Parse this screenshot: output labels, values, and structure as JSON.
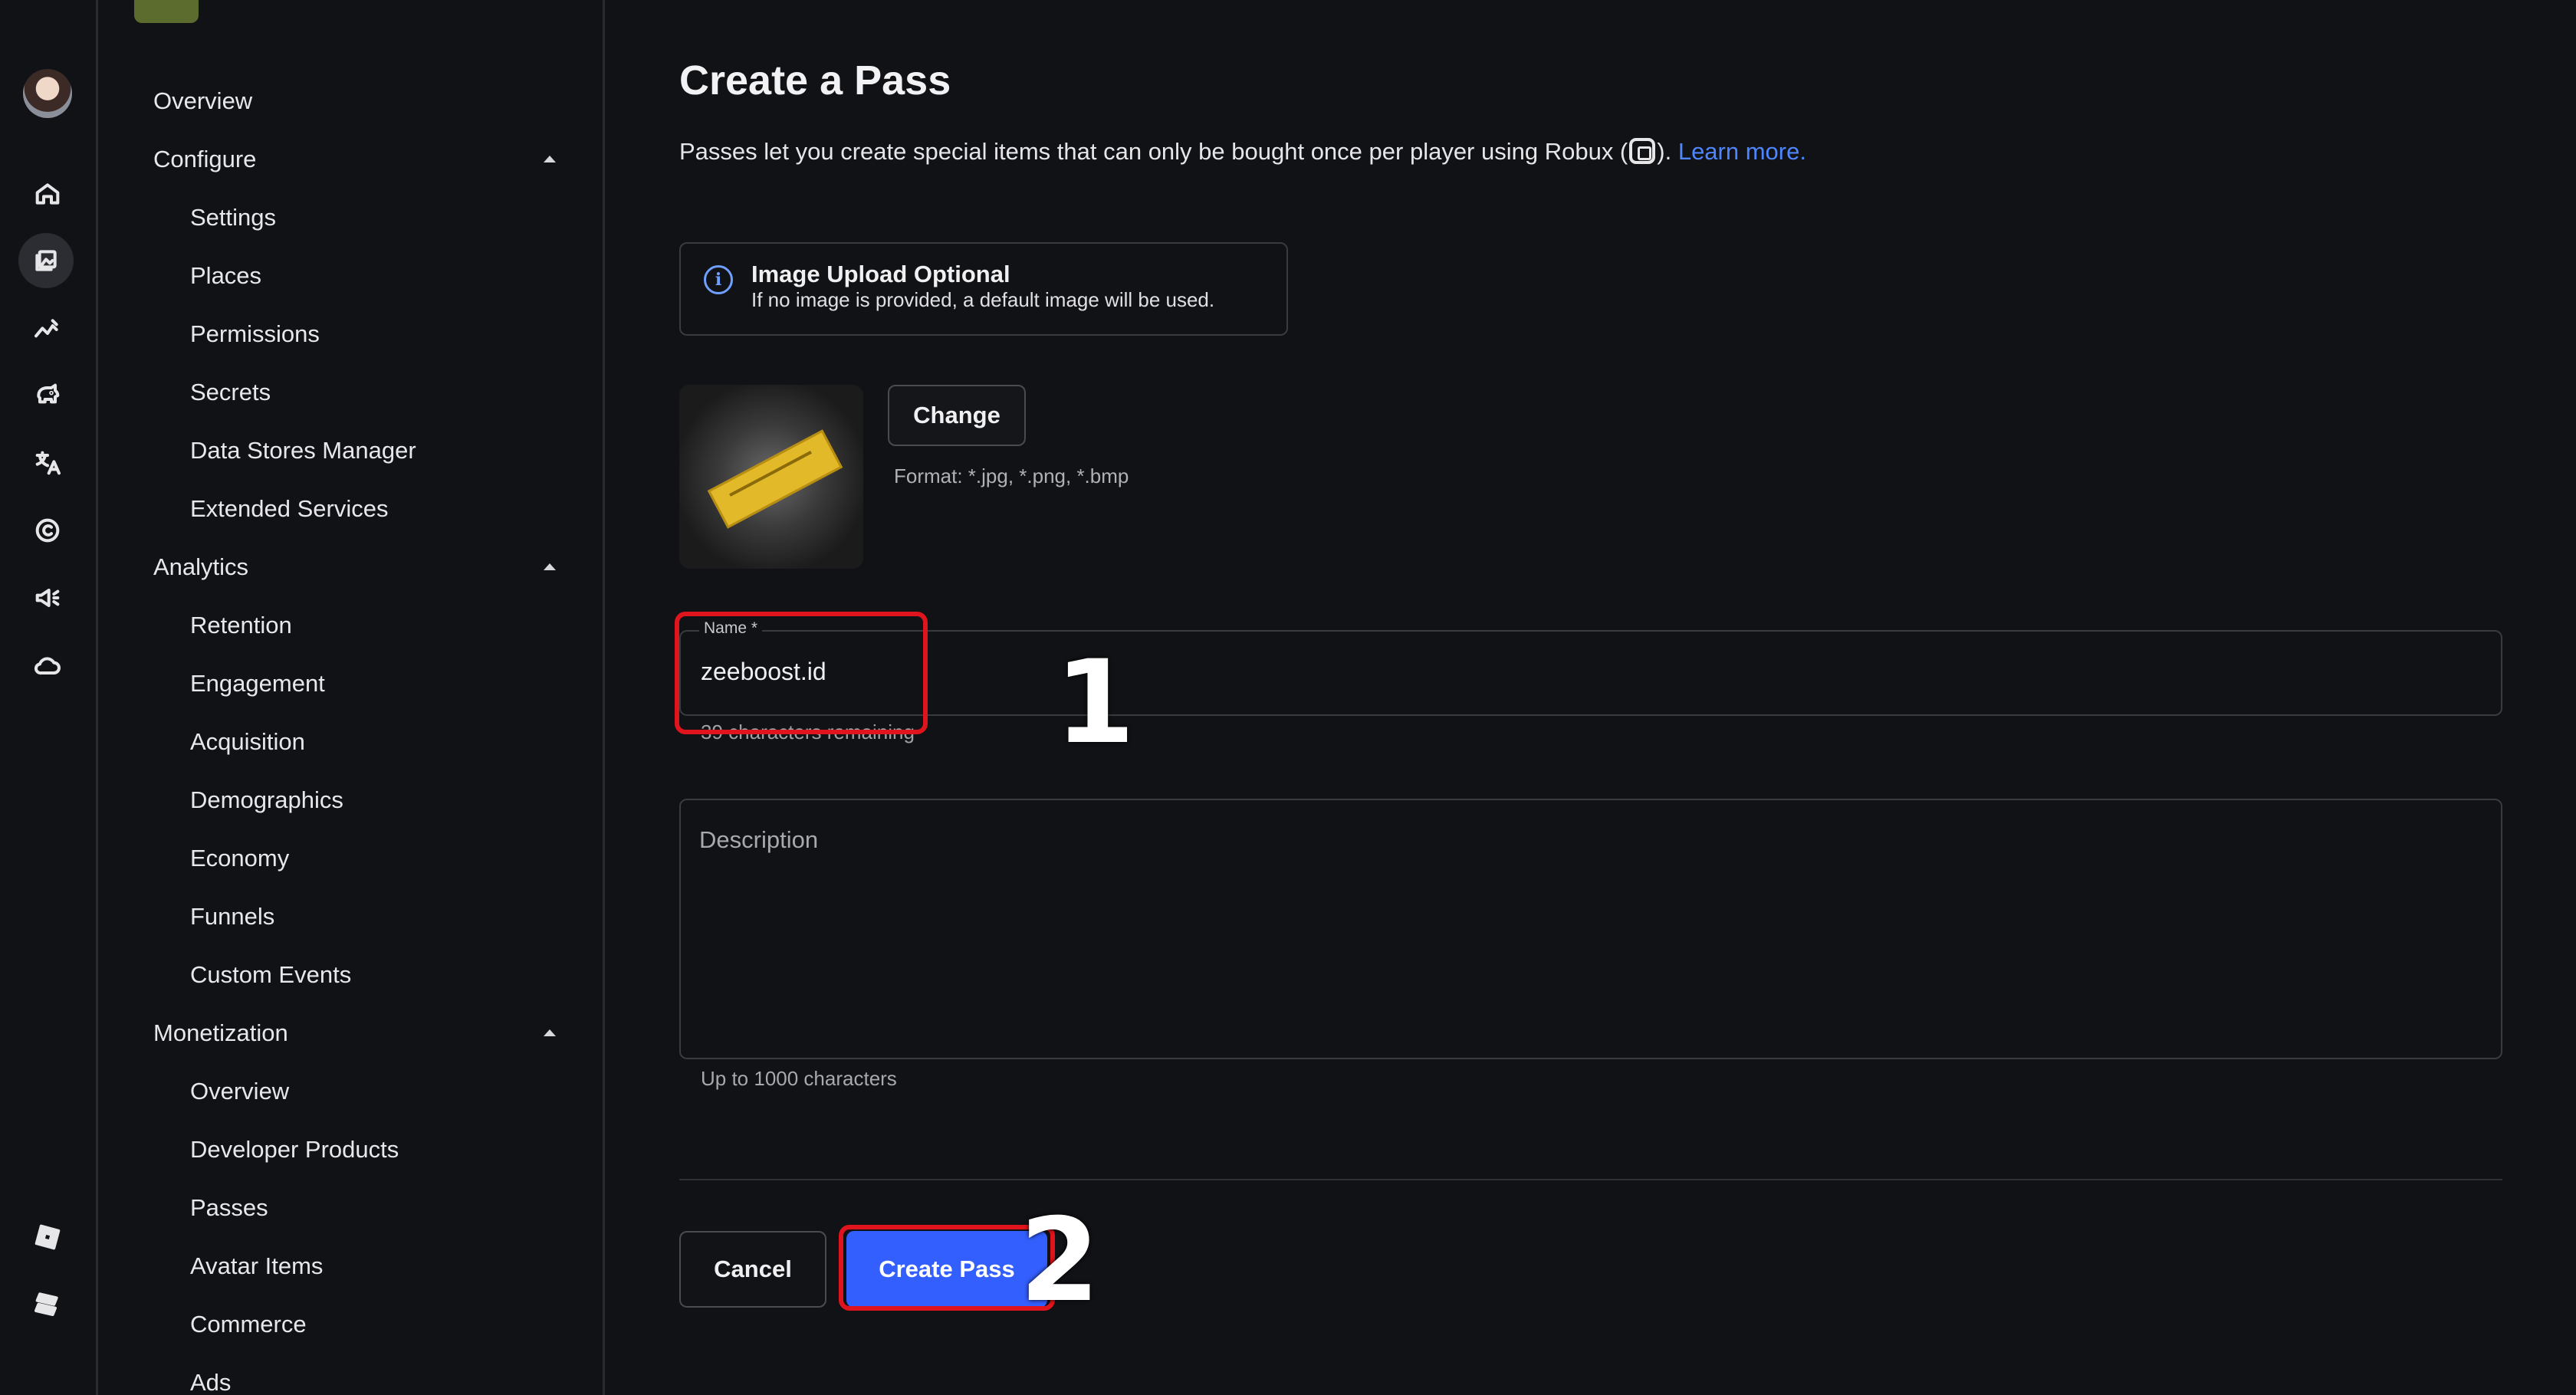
{
  "sidebar": {
    "items": [
      {
        "label": "Overview",
        "level": "top"
      },
      {
        "label": "Configure",
        "level": "top",
        "expanded": true
      },
      {
        "label": "Settings",
        "level": "sub"
      },
      {
        "label": "Places",
        "level": "sub"
      },
      {
        "label": "Permissions",
        "level": "sub"
      },
      {
        "label": "Secrets",
        "level": "sub"
      },
      {
        "label": "Data Stores Manager",
        "level": "sub"
      },
      {
        "label": "Extended Services",
        "level": "sub"
      },
      {
        "label": "Analytics",
        "level": "top",
        "expanded": true
      },
      {
        "label": "Retention",
        "level": "sub"
      },
      {
        "label": "Engagement",
        "level": "sub"
      },
      {
        "label": "Acquisition",
        "level": "sub"
      },
      {
        "label": "Demographics",
        "level": "sub"
      },
      {
        "label": "Economy",
        "level": "sub"
      },
      {
        "label": "Funnels",
        "level": "sub"
      },
      {
        "label": "Custom Events",
        "level": "sub"
      },
      {
        "label": "Monetization",
        "level": "top",
        "expanded": true
      },
      {
        "label": "Overview",
        "level": "sub"
      },
      {
        "label": "Developer Products",
        "level": "sub"
      },
      {
        "label": "Passes",
        "level": "sub"
      },
      {
        "label": "Avatar Items",
        "level": "sub"
      },
      {
        "label": "Commerce",
        "level": "sub"
      },
      {
        "label": "Ads",
        "level": "sub"
      }
    ]
  },
  "rail": {
    "icons": [
      "avatar",
      "home-icon",
      "creations-icon",
      "analytics-icon",
      "monetization-icon",
      "translate-icon",
      "copyright-icon",
      "ads-icon",
      "cloud-icon",
      "roblox-logo-icon",
      "studio-logo-icon"
    ]
  },
  "page": {
    "title": "Create a Pass",
    "intro_text": "Passes let you create special items that can only be bought once per player using Robux (",
    "intro_text_end": ").",
    "learn_more": "Learn more."
  },
  "info": {
    "title": "Image Upload Optional",
    "body": "If no image is provided, a default image will be used."
  },
  "image": {
    "change_label": "Change",
    "format_note": "Format: *.jpg, *.png, *.bmp"
  },
  "form": {
    "name_label": "Name *",
    "name_value": "zeeboost.id",
    "name_remaining": "39 characters remaining",
    "description_placeholder": "Description",
    "description_hint": "Up to 1000 characters"
  },
  "actions": {
    "cancel_label": "Cancel",
    "create_label": "Create Pass"
  },
  "annotations": {
    "step1": "1",
    "step2": "2",
    "color": "#e0141c"
  },
  "colors": {
    "background": "#111216",
    "accent": "#335fff",
    "link": "#4e86ff"
  }
}
